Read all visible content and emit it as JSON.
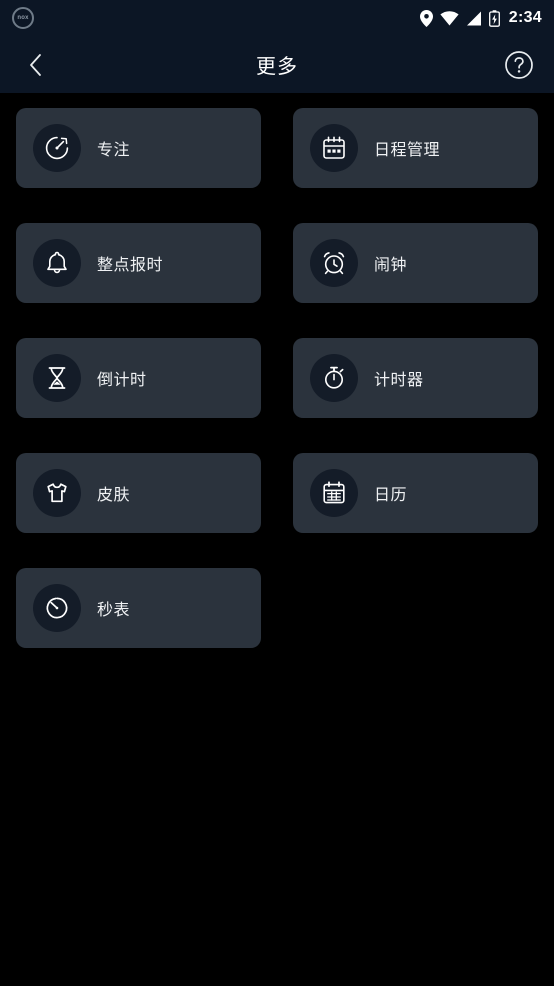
{
  "statusbar": {
    "app_logo_text": "nox",
    "logo_icon": "nox-circle-logo-icon",
    "icons": [
      "location-pin-icon",
      "wifi-icon",
      "signal-bars-icon",
      "battery-charging-icon"
    ],
    "time": "2:34"
  },
  "header": {
    "back_icon": "chevron-left-icon",
    "title": "更多",
    "help_icon": "question-mark-circle-icon"
  },
  "colors": {
    "page_background": "#000000",
    "header_background": "#0c1625",
    "card_background": "#2b333d",
    "icon_circle_background": "#141c28",
    "text_primary": "#f0f2f4",
    "icon_stroke": "#ffffff"
  },
  "grid": {
    "items": [
      {
        "label": "专注",
        "icon": "focus-gauge-icon"
      },
      {
        "label": "日程管理",
        "icon": "schedule-calendar-icon"
      },
      {
        "label": "整点报时",
        "icon": "bell-icon"
      },
      {
        "label": "闹钟",
        "icon": "alarm-clock-icon"
      },
      {
        "label": "倒计时",
        "icon": "hourglass-icon"
      },
      {
        "label": "计时器",
        "icon": "stopwatch-icon"
      },
      {
        "label": "皮肤",
        "icon": "tshirt-skin-icon"
      },
      {
        "label": "日历",
        "icon": "calendar-icon"
      },
      {
        "label": "秒表",
        "icon": "stopwatch-dial-icon"
      }
    ]
  }
}
